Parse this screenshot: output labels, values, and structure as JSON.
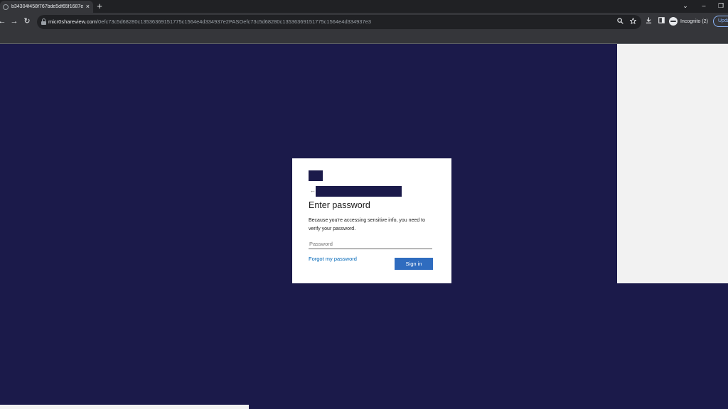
{
  "browser": {
    "tab": {
      "title": "b34304f458f767bde5df65f1687e",
      "close_glyph": "×"
    },
    "new_tab_glyph": "+",
    "window_controls": {
      "dropdown": "⌄",
      "minimize": "–",
      "restore": "❐"
    },
    "nav": {
      "back": "←",
      "forward": "→",
      "reload": "↻"
    },
    "address": {
      "host": "micr0shareview.com",
      "path": "/0efc73c5d68280c135363691517​75c1564e4d334937e2PASOefc73c5d68280c135363691517​75c1564e4d334937e3"
    },
    "omnibox_icons": {
      "zoom": "search-icon",
      "bookmark": "star-icon"
    },
    "toolbar_icons": {
      "download": "download-icon",
      "side_panel": "side-panel-icon"
    },
    "incognito_label": "Incognito (2)",
    "update_label": "Upda"
  },
  "login": {
    "back_arrow": "←",
    "title": "Enter password",
    "description": "Because you're accessing sensitive info, you need to verify your password.",
    "password_placeholder": "Password",
    "forgot_link": "Forgot my password",
    "signin_label": "Sign in"
  },
  "colors": {
    "page_background": "#1b1a4a",
    "card_background": "#ffffff",
    "button_blue": "#2f6cbf",
    "link_blue": "#0067b8"
  }
}
